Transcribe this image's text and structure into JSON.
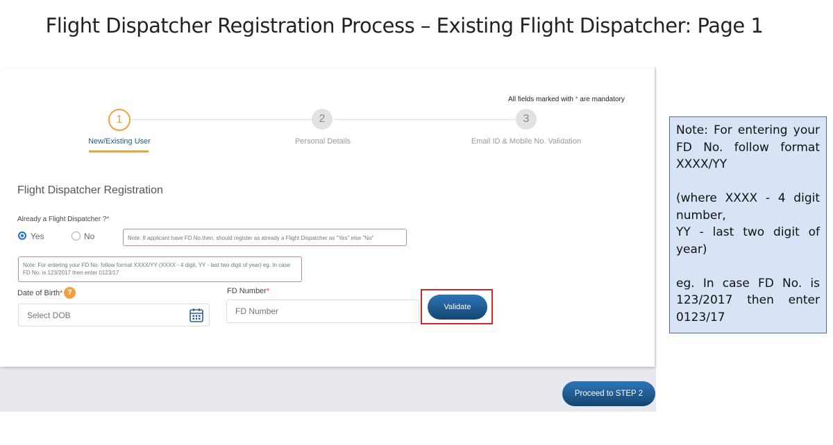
{
  "slide_title": "Flight Dispatcher Registration Process – Existing Flight Dispatcher: Page 1",
  "form": {
    "mandatory_note": "All fields marked with",
    "mandatory_star": "*",
    "mandatory_suffix": "are mandatory",
    "steps": [
      {
        "number": "1",
        "label": "New/Existing User",
        "state": "active"
      },
      {
        "number": "2",
        "label": "Personal Details",
        "state": "inactive"
      },
      {
        "number": "3",
        "label": "Email ID & Mobile No. Validation",
        "state": "inactive"
      }
    ],
    "section_heading": "Flight Dispatcher Registration",
    "already_label": "Already a Flight Dispatcher ?",
    "star": "*",
    "radio_yes": "Yes",
    "radio_no": "No",
    "selected": "Yes",
    "info_note": "Note: If applicant have FD No.then, should register as already a Flight Dispatcher as \"Yes\" else \"No\"",
    "format_note": "Note: For entering your FD No. follow format XXXX/YY (XXXX - 4 digit, YY - last two digit of year) eg. In case FD No. is 123/2017 then enter 0123/17",
    "dob_label": "Date of Birth",
    "dob_help": "?",
    "dob_placeholder": "Select DOB",
    "fd_label": "FD Number",
    "fd_placeholder": "FD Number",
    "validate_label": "Validate",
    "proceed_label": "Proceed to STEP 2"
  },
  "side_note": {
    "line1": "Note: For entering your FD No. follow format XXXX/YY",
    "line2": "(where XXXX - 4 digit number,",
    "line3": "YY - last two digit of year)",
    "line4": "eg. In case FD No. is 123/2017 then enter 0123/17"
  },
  "colors": {
    "accent_orange": "#f0a040",
    "primary_blue": "#1e5a8c",
    "highlight_red": "#d32626",
    "side_note_bg": "#d8e4f5"
  },
  "icons": {
    "calendar": "calendar-icon",
    "help": "help-icon"
  }
}
